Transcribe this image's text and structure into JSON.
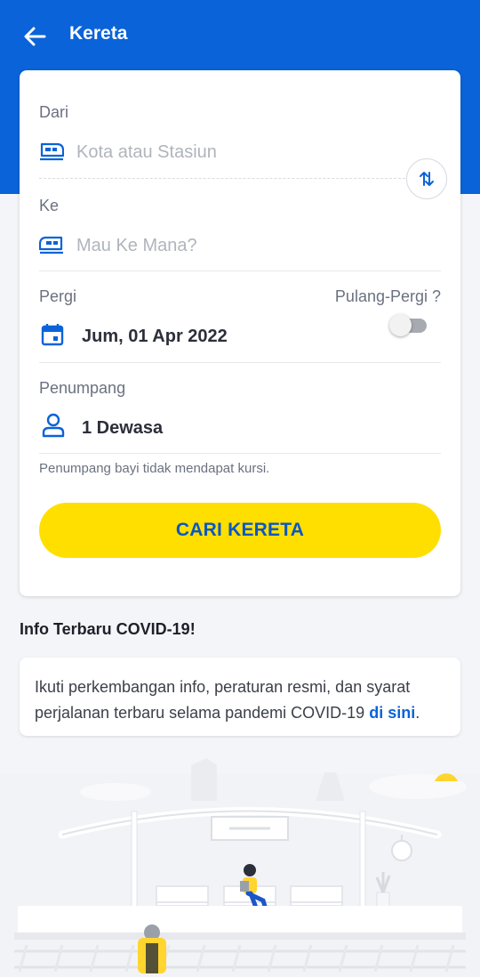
{
  "header": {
    "title": "Kereta"
  },
  "form": {
    "from": {
      "label": "Dari",
      "placeholder": "Kota atau Stasiun"
    },
    "to": {
      "label": "Ke",
      "placeholder": "Mau Ke Mana?"
    },
    "depart": {
      "label": "Pergi",
      "value": "Jum, 01 Apr 2022"
    },
    "round_trip": {
      "label": "Pulang-Pergi ?",
      "enabled": false
    },
    "passenger": {
      "label": "Penumpang",
      "value": "1 Dewasa"
    },
    "note": "Penumpang bayi tidak mendapat kursi.",
    "search_label": "CARI KERETA"
  },
  "covid": {
    "title": "Info Terbaru COVID-19!",
    "text": "Ikuti perkembangan info, peraturan resmi, dan syarat perjalanan terbaru selama pandemi COVID-19 ",
    "link": "di sini",
    "suffix": "."
  },
  "colors": {
    "primary": "#0a63d8",
    "button": "#ffdf00",
    "button_text": "#0b57c3"
  },
  "icons": [
    "back-arrow-icon",
    "train-icon",
    "swap-icon",
    "calendar-icon",
    "person-icon"
  ]
}
